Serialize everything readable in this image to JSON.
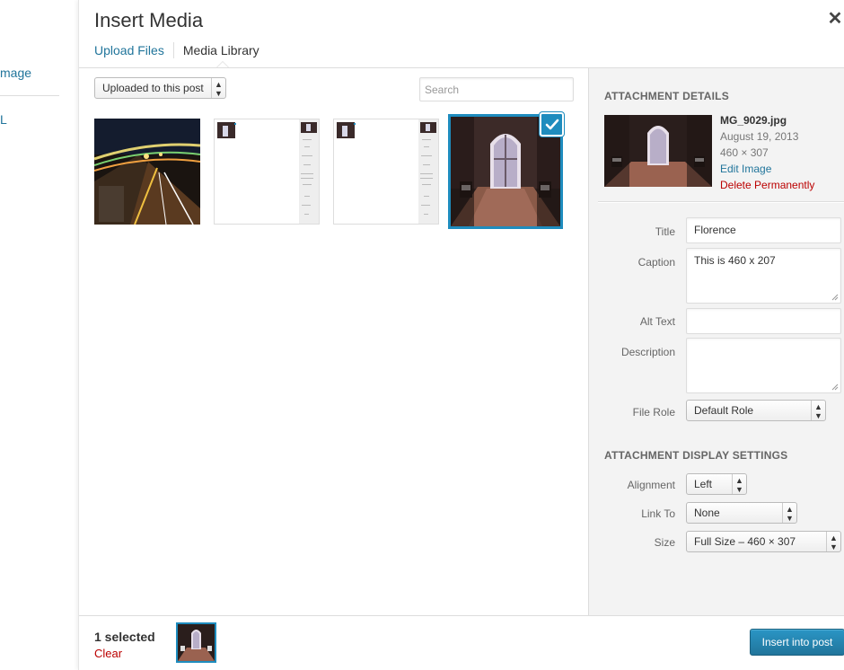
{
  "sidebar_links": {
    "image_label": "mage",
    "url_label": "L"
  },
  "modal": {
    "title": "Insert Media",
    "tabs": [
      {
        "label": "Upload Files"
      },
      {
        "label": "Media Library"
      }
    ]
  },
  "browser": {
    "filter": {
      "selected": "Uploaded to this post"
    },
    "search": {
      "placeholder": "Search",
      "value": ""
    }
  },
  "details": {
    "heading": "ATTACHMENT DETAILS",
    "filename": "MG_9029.jpg",
    "date": "August 19, 2013",
    "dimensions": "460 × 307",
    "edit_link": "Edit Image",
    "delete_link": "Delete Permanently",
    "fields": {
      "title_label": "Title",
      "title_value": "Florence",
      "caption_label": "Caption",
      "caption_value": "This is 460 x 207",
      "alt_label": "Alt Text",
      "alt_value": "",
      "description_label": "Description",
      "description_value": "",
      "file_role_label": "File Role",
      "file_role_value": "Default Role"
    }
  },
  "display_settings": {
    "heading": "ATTACHMENT DISPLAY SETTINGS",
    "alignment_label": "Alignment",
    "alignment_value": "Left",
    "link_label": "Link To",
    "link_value": "None",
    "size_label": "Size",
    "size_value": "Full Size – 460 × 307"
  },
  "footer": {
    "selected_count": "1 selected",
    "clear_label": "Clear",
    "insert_label": "Insert into post"
  },
  "colors": {
    "accent": "#1e8cbe",
    "link": "#21759b",
    "danger": "#bb0000"
  }
}
